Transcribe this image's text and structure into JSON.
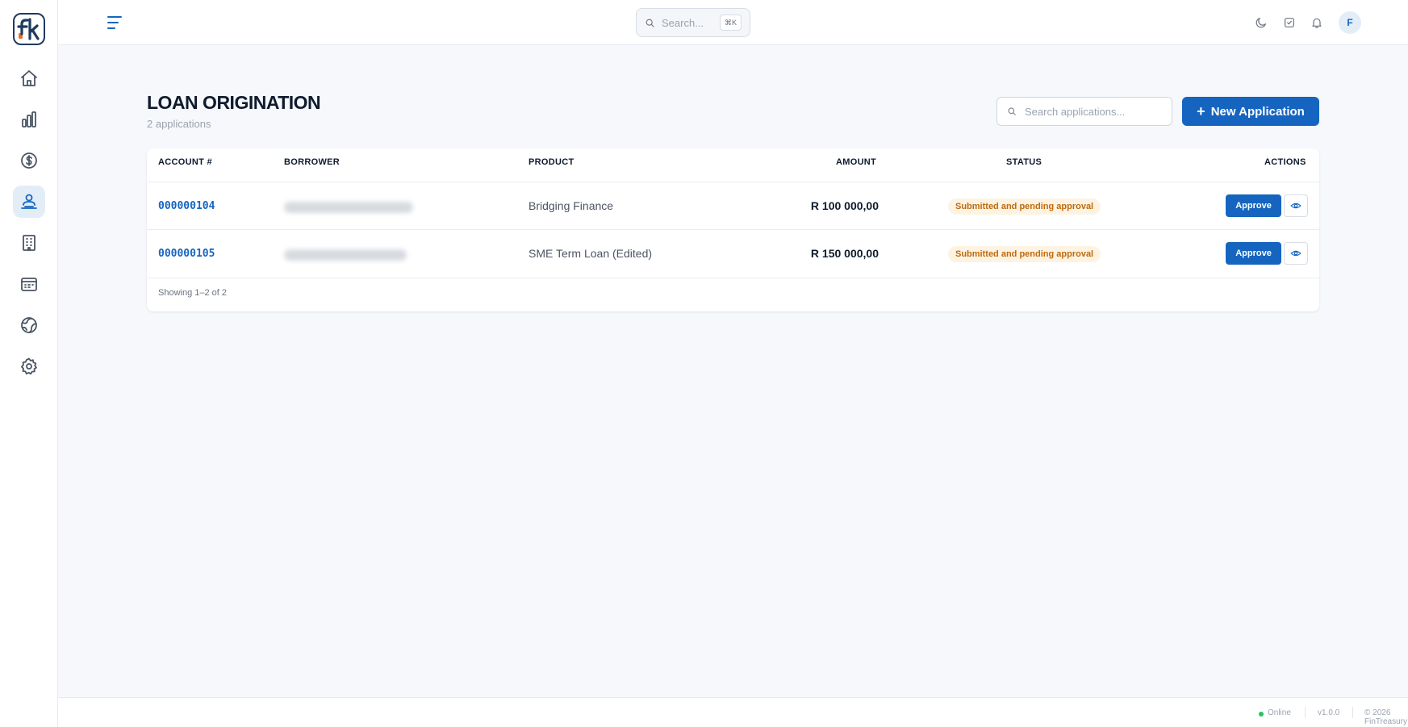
{
  "app": {
    "logo_text": "fk"
  },
  "topbar": {
    "search_placeholder": "Search...",
    "search_shortcut": "⌘K",
    "avatar_initial": "F"
  },
  "sidebar": {
    "items": [
      {
        "icon": "home-icon",
        "active": false
      },
      {
        "icon": "bar-chart-icon",
        "active": false
      },
      {
        "icon": "dollar-icon",
        "active": false
      },
      {
        "icon": "users-icon",
        "active": true
      },
      {
        "icon": "building-icon",
        "active": false
      },
      {
        "icon": "calendar-icon",
        "active": false
      },
      {
        "icon": "globe-icon",
        "active": false
      },
      {
        "icon": "gear-icon",
        "active": false
      }
    ]
  },
  "page": {
    "title": "LOAN ORIGINATION",
    "subtitle": "2 applications",
    "search_placeholder": "Search applications...",
    "new_button": "New Application"
  },
  "table": {
    "columns": [
      "ACCOUNT #",
      "BORROWER",
      "PRODUCT",
      "AMOUNT",
      "STATUS",
      "ACTIONS"
    ],
    "rows": [
      {
        "account": "000000104",
        "product": "Bridging Finance",
        "amount": "R 100 000,00",
        "status": "Submitted and pending approval",
        "action": "Approve"
      },
      {
        "account": "000000105",
        "product": "SME Term Loan (Edited)",
        "amount": "R 150 000,00",
        "status": "Submitted and pending approval",
        "action": "Approve"
      }
    ],
    "footer": "Showing 1–2 of 2"
  },
  "footer": {
    "status": "Online",
    "version": "v1.0.0",
    "copyright": "© 2026 FinTreasury"
  },
  "colors": {
    "accent": "#1565c0",
    "status_warning_text": "#c06a0a",
    "status_warning_bg": "#fdf3e3",
    "online": "#22c55e"
  }
}
